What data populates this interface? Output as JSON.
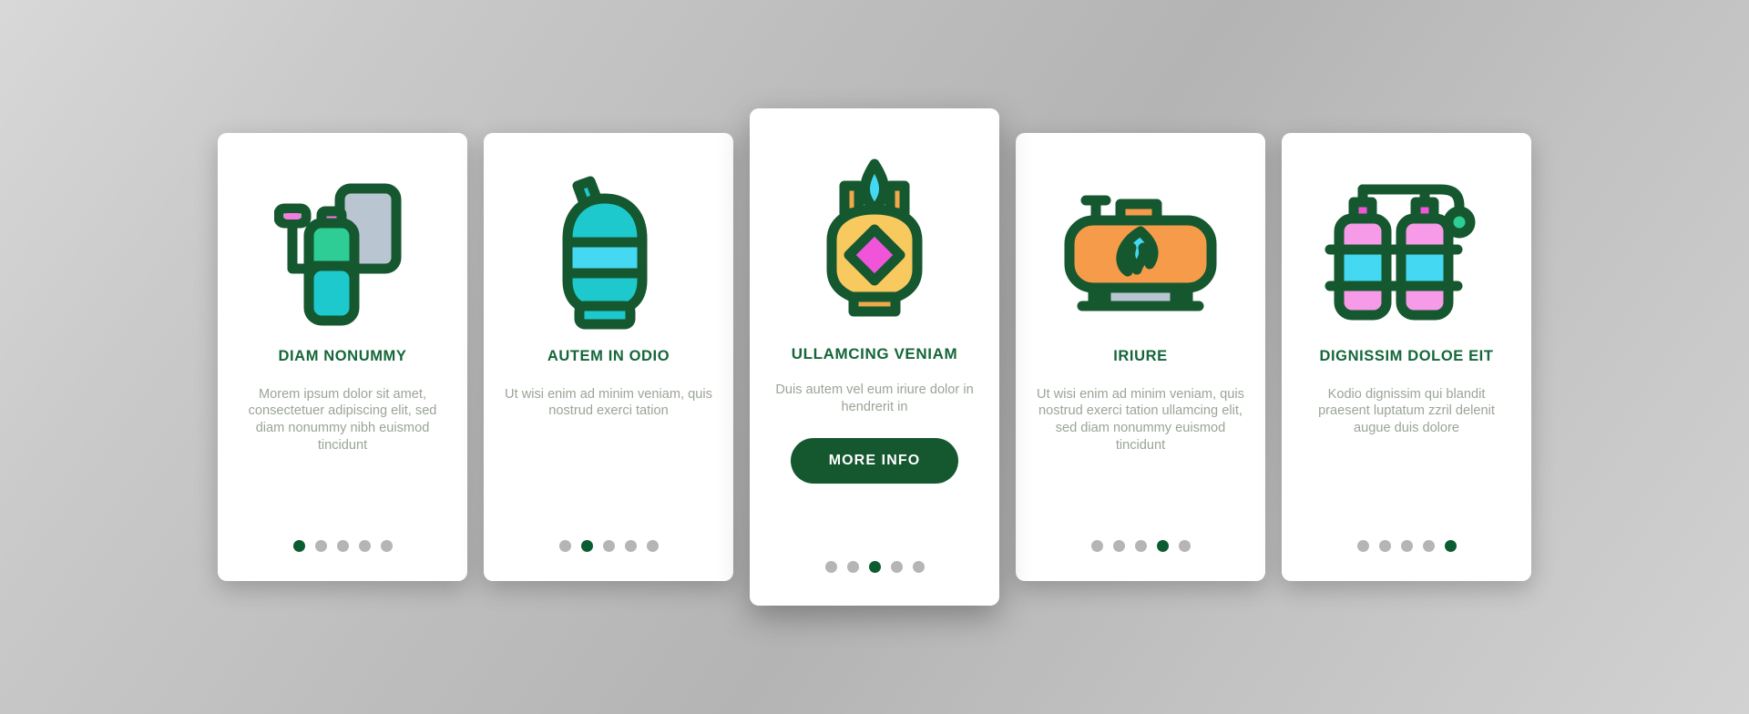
{
  "theme": {
    "accent_green": "#15663a",
    "button_green": "#15572f",
    "dot_inactive": "#b5b5b5",
    "dot_active": "#0c5c31",
    "body_text": "#9aa597",
    "card_bg": "#ffffff",
    "page_bg": "#c6c6c6"
  },
  "cards": [
    {
      "icon": "gas-cylinder-with-regulator-icon",
      "title": "DIAM NONUMMY",
      "body": "Morem ipsum dolor sit amet, consectetuer adipiscing elit, sed diam nonummy nibh euismod tincidunt",
      "dots": {
        "count": 5,
        "active_index": 0
      },
      "has_cta": false
    },
    {
      "icon": "propane-bottle-icon",
      "title": "AUTEM IN ODIO",
      "body": "Ut wisi enim ad minim veniam, quis nostrud exerci tation",
      "dots": {
        "count": 5,
        "active_index": 1
      },
      "has_cta": false
    },
    {
      "icon": "lpg-tank-flame-icon",
      "title": "ULLAMCING VENIAM",
      "body": "Duis autem vel eum iriure dolor in hendrerit in",
      "cta_label": "MORE INFO",
      "dots": {
        "count": 5,
        "active_index": 2
      },
      "has_cta": true
    },
    {
      "icon": "horizontal-gas-tank-flame-icon",
      "title": "IRIURE",
      "body": "Ut wisi enim ad minim veniam, quis nostrud exerci tation ullamcing elit, sed diam nonummy euismod tincidunt",
      "dots": {
        "count": 5,
        "active_index": 3
      },
      "has_cta": false
    },
    {
      "icon": "twin-gas-cylinders-icon",
      "title": "DIGNISSIM DOLOE EIT",
      "body": "Kodio dignissim qui blandit praesent luptatum zzril delenit augue duis dolore",
      "dots": {
        "count": 5,
        "active_index": 4
      },
      "has_cta": false
    }
  ]
}
